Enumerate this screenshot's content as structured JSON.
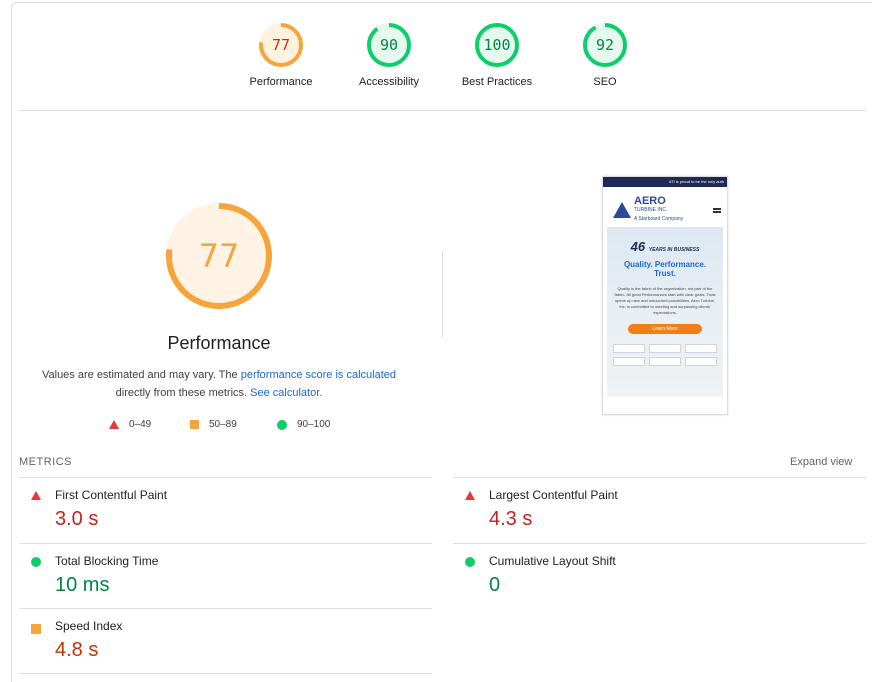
{
  "gauges": [
    {
      "score": "77",
      "label": "Performance",
      "value": 77,
      "color": "#f5a53b",
      "fill": "#fff3e0",
      "text": "#c33300"
    },
    {
      "score": "90",
      "label": "Accessibility",
      "value": 90,
      "color": "#0cce6b",
      "fill": "#e6f9ee",
      "text": "#018642"
    },
    {
      "score": "100",
      "label": "Best Practices",
      "value": 100,
      "color": "#0cce6b",
      "fill": "#e6f9ee",
      "text": "#018642"
    },
    {
      "score": "92",
      "label": "SEO",
      "value": 92,
      "color": "#0cce6b",
      "fill": "#e6f9ee",
      "text": "#018642"
    }
  ],
  "performance": {
    "score": "77",
    "value": 77,
    "title": "Performance",
    "desc_prefix": "Values are estimated and may vary. The ",
    "desc_link": "performance score is calculated",
    "desc_mid": " directly from these metrics. ",
    "desc_calc": "See calculator.",
    "ring_color": "#f5a53b",
    "text_color": "#f5a53b"
  },
  "legend": {
    "fail": "0–49",
    "average": "50–89",
    "pass": "90–100"
  },
  "thumbnail": {
    "topbar": "ATI is proud to be the only auth",
    "brand": "AERO",
    "brand_sub": "TURBINE INC.",
    "brand_tiny": "A Starboard Company",
    "badge": "46",
    "badge_small": "YEARS IN BUSINESS",
    "tagline_1": "Quality. Performance.",
    "tagline_2": "Trust.",
    "copy": "Quality is the fabric of the organization, not part of the fabric. All good Performances start with clear goals. Trust opens up new and untouched possibilities. Aero Turbine, Inc. is committed to meeting and surpassing clients' expectations.",
    "cta": "Learn More"
  },
  "metrics": {
    "heading": "METRICS",
    "expand": "Expand view",
    "items": [
      {
        "label": "First Contentful Paint",
        "value": "3.0 s",
        "rating": "fail"
      },
      {
        "label": "Largest Contentful Paint",
        "value": "4.3 s",
        "rating": "fail"
      },
      {
        "label": "Total Blocking Time",
        "value": "10 ms",
        "rating": "pass"
      },
      {
        "label": "Cumulative Layout Shift",
        "value": "0",
        "rating": "pass"
      },
      {
        "label": "Speed Index",
        "value": "4.8 s",
        "rating": "average"
      }
    ]
  }
}
